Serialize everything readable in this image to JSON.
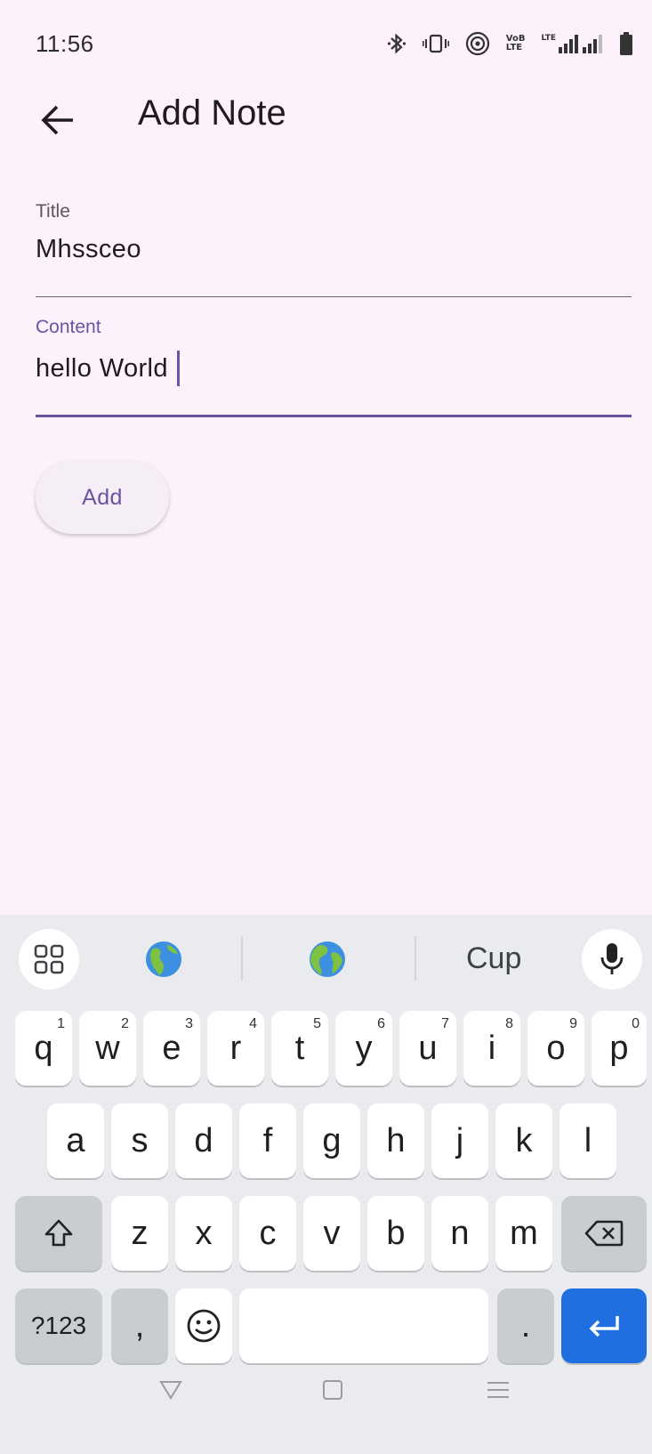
{
  "status_bar": {
    "time": "11:56",
    "network_label_top": "VoB",
    "network_label_bottom": "LTE",
    "lte_label": "LTE"
  },
  "app_bar": {
    "title": "Add Note"
  },
  "form": {
    "title_label": "Title",
    "title_value": "Mhssceo",
    "content_label": "Content",
    "content_value": "hello World",
    "add_button_label": "Add"
  },
  "keyboard": {
    "suggestion": "Cup",
    "row1": [
      {
        "key": "q",
        "hint": "1"
      },
      {
        "key": "w",
        "hint": "2"
      },
      {
        "key": "e",
        "hint": "3"
      },
      {
        "key": "r",
        "hint": "4"
      },
      {
        "key": "t",
        "hint": "5"
      },
      {
        "key": "y",
        "hint": "6"
      },
      {
        "key": "u",
        "hint": "7"
      },
      {
        "key": "i",
        "hint": "8"
      },
      {
        "key": "o",
        "hint": "9"
      },
      {
        "key": "p",
        "hint": "0"
      }
    ],
    "row2": [
      "a",
      "s",
      "d",
      "f",
      "g",
      "h",
      "j",
      "k",
      "l"
    ],
    "row3": [
      "z",
      "x",
      "c",
      "v",
      "b",
      "n",
      "m"
    ],
    "symbols_label": "?123",
    "comma_label": ",",
    "period_label": ".",
    "accent_color": "#1f6fe0"
  },
  "colors": {
    "background": "#fdf2fb",
    "primary": "#6b52a3"
  }
}
